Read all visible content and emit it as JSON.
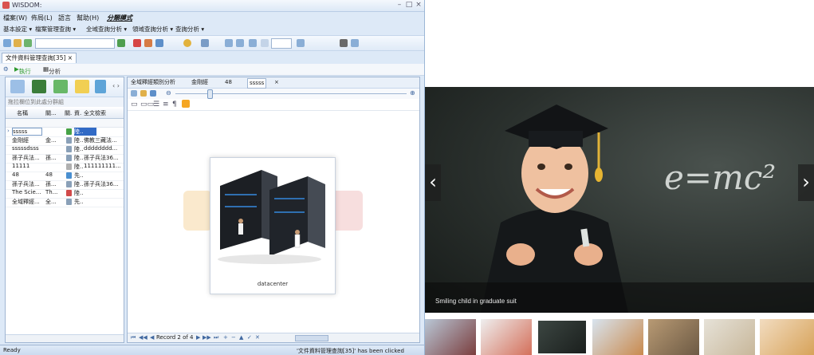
{
  "app": {
    "title": "WISDOM:",
    "menu": [
      "檔案(W)",
      "佈局(L)",
      "語言",
      "幫助(H)",
      "分類模式"
    ],
    "nav": [
      "基本設定 ▾",
      "檔案管理查詢 ▾",
      "全域查詢分析 ▾",
      "領域查詢分析 ▾",
      "查詢分析 ▾"
    ],
    "doc_tab": "文件資料管理查詢[35]",
    "doc_tab_close": "×",
    "actions": {
      "execute": "執行",
      "analyze": "分析"
    },
    "left_pane": {
      "group_hint": "拖拉欄位到此處分群組",
      "columns": [
        "名稱",
        "關...",
        "關.",
        "資.",
        "全文檢索"
      ],
      "rows": [
        [
          "sssss",
          "",
          "",
          "陸..",
          ""
        ],
        [
          "金剛經",
          "金...",
          "",
          "陸..",
          "佛教三藏法..."
        ],
        [
          "sssssdsss",
          "",
          "",
          "陸..",
          "dddddddd..."
        ],
        [
          "孫子兵法...",
          "孫...",
          "",
          "陸..",
          "孫子兵法36..."
        ],
        [
          "11111",
          "",
          "",
          "陸..",
          "111111111..."
        ],
        [
          "48",
          "48",
          "",
          "先..",
          ""
        ],
        [
          "孫子兵法...",
          "孫...",
          "",
          "陸..",
          "孫子兵法36..."
        ],
        [
          "The Scie...",
          "Th...",
          "",
          "陸..",
          ""
        ],
        [
          "全域釋經...",
          "全...",
          "",
          "先..",
          ""
        ]
      ]
    },
    "right_pane": {
      "tabs": [
        "全域釋經類別分析",
        "金剛經",
        "48",
        "sssss"
      ],
      "tab_close": "×",
      "card_label": "datacenter",
      "record_text": "Record 2 of 4"
    },
    "status": {
      "left": "Ready",
      "right": "'文件資料管理查詢[35]' has been clicked"
    }
  },
  "slider": {
    "caption": "Smiling child in graduate suit",
    "formula": "e=mc²",
    "prev": "‹",
    "next": "›",
    "thumbnails": [
      "thumb-1",
      "thumb-2",
      "thumb-3",
      "thumb-4",
      "thumb-5",
      "thumb-6",
      "thumb-7"
    ]
  }
}
